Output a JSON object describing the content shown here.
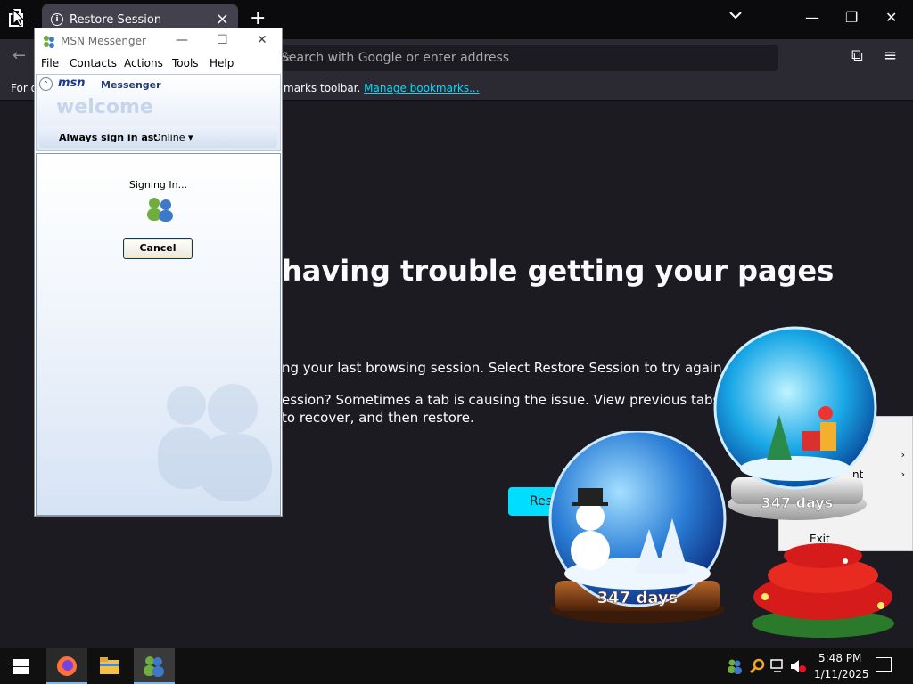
{
  "browser": {
    "tab_title": "Restore Session",
    "url_placeholder": "Search with Google or enter address",
    "bookmarks_prefix": "For q",
    "bookmarks_text": "marks toolbar.",
    "bookmarks_link": "Manage bookmarks..."
  },
  "page": {
    "heading": "having trouble getting your pages",
    "p1": "ng your last browsing session. Select Restore Session to try again.",
    "p2": "ession? Sometimes a tab is causing the issue. View previous tabs, remove",
    "p3": "to recover, and then restore.",
    "restore_button": "Res"
  },
  "context_menu": {
    "items": [
      {
        "label": "",
        "has_submenu": true
      },
      {
        "label": "nt",
        "has_submenu": true
      },
      {
        "label": "Exit",
        "has_submenu": false
      }
    ]
  },
  "globes": {
    "big": {
      "label": "347 days"
    },
    "small": {
      "label": "347 days"
    }
  },
  "msn": {
    "title": "MSN Messenger",
    "menu": [
      "File",
      "Contacts",
      "Actions",
      "Tools",
      "Help"
    ],
    "logo": "msn",
    "logo_sub": "Messenger",
    "welcome": "welcome",
    "signin_label": "Always sign in as:",
    "status": "Online",
    "signing_text": "Signing In...",
    "cancel": "Cancel"
  },
  "taskbar": {
    "time": "5:48 PM",
    "date": "1/11/2025"
  },
  "colors": {
    "accent": "#00ddff",
    "page_bg": "#1c1b22",
    "toolbar_bg": "#2b2a33"
  }
}
